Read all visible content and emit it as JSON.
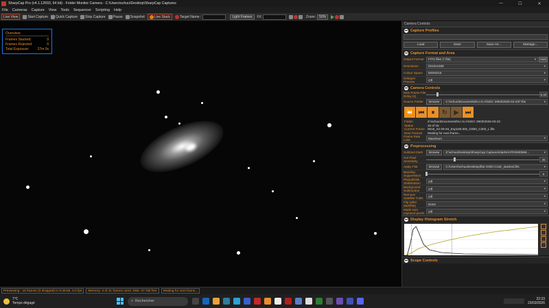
{
  "window": {
    "title": "SharpCap Pro (v4.1.12693, 64 bit) - Folder Monitor Camera - C:\\Users\\schuu\\Desktop\\SharpCap Captures",
    "controls": [
      "—",
      "☐",
      "✕"
    ]
  },
  "menu": [
    "File",
    "Cameras",
    "Capture",
    "View",
    "Tools",
    "Sequencer",
    "Scripting",
    "Help"
  ],
  "toolbar": {
    "live_view": "Live View",
    "start_capture": "Start Capture",
    "quick_capture": "Quick Capture",
    "stop_capture": "Stop Capture",
    "pause": "Pause",
    "snapshot": "Snapshot",
    "live_stack": "Live Stack",
    "target_name_label": "Target Name :",
    "light_frames": "Light Frames",
    "fx_label": "FX",
    "zoom_label": "Zoom:",
    "zoom_value": "50%"
  },
  "overview": {
    "title": "Overview",
    "rows": [
      {
        "label": "Frames Stacked:",
        "value": "9"
      },
      {
        "label": "Frames Rejected:",
        "value": "0"
      },
      {
        "label": "Total Exposure:",
        "value": "27m 0s"
      }
    ]
  },
  "panel": {
    "header": "Camera Controls",
    "capture_profiles": {
      "title": "Capture Profiles",
      "buttons": [
        "Load",
        "Save",
        "Save As...",
        "Manage..."
      ]
    },
    "format_area": {
      "title": "Capture Format and Area",
      "rows": [
        {
          "label": "Output Format",
          "value": "FITS files (*.fits)"
        },
        {
          "label": "Resolution",
          "value": "6224x4168"
        },
        {
          "label": "Colour Space",
          "value": "MONO16"
        },
        {
          "label": "Debayer Preview",
          "value": "Off"
        }
      ],
      "auto_label": "Auto"
    },
    "camera_controls": {
      "title": "Camera Controls",
      "new_frame_label": "New Frame File Delay (s)",
      "new_frame_value": "5.00",
      "new_frame_level": 0.1,
      "source_folder_label": "Source Folder",
      "browse": "Browse",
      "source_folder_value": "C:\\schuu\\Documents\\N.I.N.A\\NGC 2903\\2026-03-23\\*.fits",
      "info": [
        {
          "k": "Folder",
          "v": "Z:\\schuu\\Documents\\N.I.N.A\\NGC 2903\\2026-03-23"
        },
        {
          "k": "Status",
          "v": "15 of 15"
        },
        {
          "k": "Current Frame",
          "v": "0016_22-29-46_Exp180.00s_O300_C303_L.fits"
        },
        {
          "k": "Next Frames",
          "v": "Waiting for next frame..."
        }
      ],
      "frame_rate_label": "Frame Rate Limit",
      "frame_rate_value": "Maximum"
    },
    "preprocessing": {
      "title": "Preprocessing",
      "subtract_dark_label": "Subtract Dark",
      "subtract_dark_value": "Z:\\schuu\\Desktop\\SharpCap Captures\\darks\\ATR2600MM...",
      "hot_pixel_label": "Hot Pixel Sensitivity",
      "hot_pixel_value": "25",
      "hot_pixel_level": 0.25,
      "apply_flat_label": "Apply Flat",
      "apply_flat_value": "C:\\Users\\schuu\\Desktop\\flat O300 C11E_stacked.fits",
      "banding_label": "Banding Suppression",
      "banding_value": "0",
      "banding_level": 0,
      "rows": [
        {
          "label": "Planet/Disk Stabilization",
          "value": "Off"
        },
        {
          "label": "Background Subtraction",
          "value": "Off"
        },
        {
          "label": "Remove Satellite Trails",
          "value": "Off"
        },
        {
          "label": "Flip (after dark/flat)",
          "value": "None"
        },
        {
          "label": "Mask over exposed pixels",
          "value": "Off"
        }
      ]
    },
    "histogram": {
      "title": "Display Histogram Stretch"
    },
    "scope_controls": {
      "title": "Scope Controls"
    }
  },
  "statusbar": {
    "preview": "Previewing : 15 frames (0 dropped) in 0:46:55, 0.0 fps",
    "memory": "Memory: 4 of 41 frames used. Disk: 37 GB free",
    "waiting": "Waiting for next frame..."
  },
  "taskbar": {
    "temp": "7°C",
    "weather": "Temps dégagé",
    "search_placeholder": "Rechercher",
    "time": "22:33",
    "date": "23/03/2026"
  },
  "colors": {
    "accent": "#e8902a",
    "brand": "#c0392b",
    "overview_border": "#1f7ae0"
  }
}
